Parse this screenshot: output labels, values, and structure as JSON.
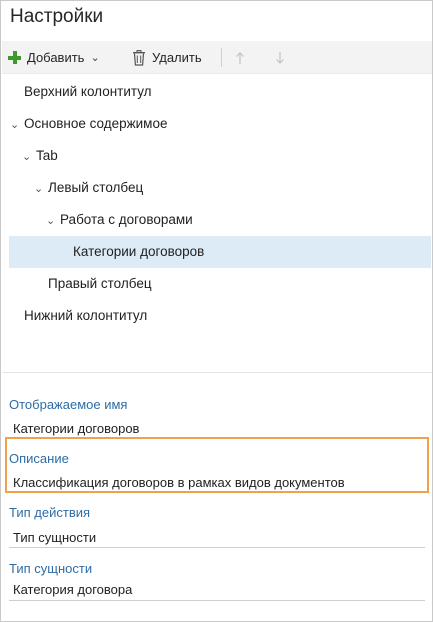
{
  "panel": {
    "title": "Настройки"
  },
  "toolbar": {
    "add_label": "Добавить",
    "add_icon": "plus-icon",
    "delete_label": "Удалить",
    "delete_icon": "trash-icon",
    "up_icon": "arrow-up-icon",
    "down_icon": "arrow-down-icon"
  },
  "tree": {
    "items": [
      {
        "label": "Верхний колонтитул"
      },
      {
        "label": "Основное содержимое"
      },
      {
        "label": "Tab"
      },
      {
        "label": "Левый столбец"
      },
      {
        "label": "Работа с договорами"
      },
      {
        "label": "Категории договоров"
      },
      {
        "label": "Правый столбец"
      },
      {
        "label": "Нижний колонтитул"
      }
    ]
  },
  "properties": {
    "display_name": {
      "label": "Отображаемое имя",
      "value": "Категории договоров"
    },
    "description": {
      "label": "Описание",
      "value": "Классификация договоров в рамках видов документов"
    },
    "action_type": {
      "label": "Тип действия",
      "value": "Тип сущности"
    },
    "entity_type": {
      "label": "Тип сущности",
      "value": "Категория договора"
    }
  },
  "colors": {
    "accent_label": "#2e6ca4",
    "selection": "#ddebf7",
    "highlight_border": "#f0a24a",
    "add_icon": "#3c9a2b"
  }
}
